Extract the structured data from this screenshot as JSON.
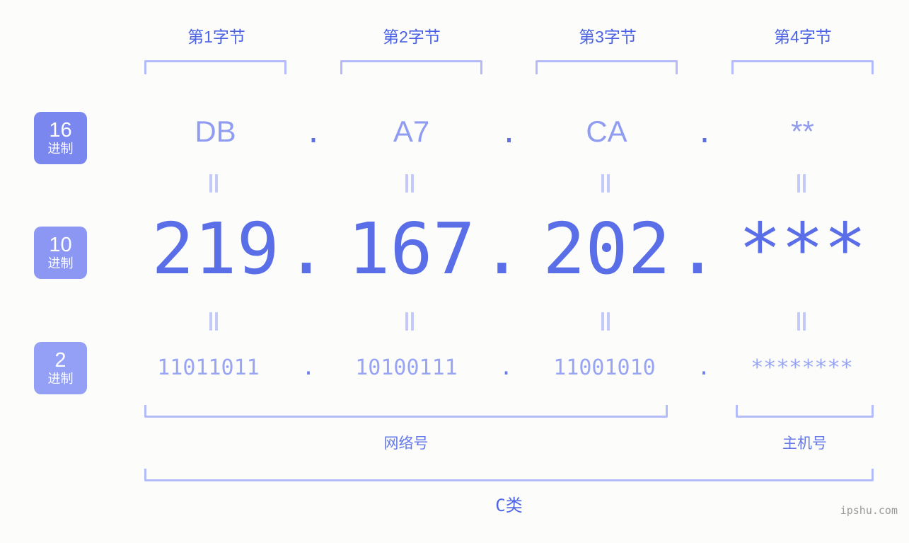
{
  "page": {
    "background": "#fcfdfa",
    "accent": "#5a6ee8",
    "accent_light": "#b3bcf9",
    "watermark": "ipshu.com"
  },
  "byte_headers": [
    {
      "label": "第1字节"
    },
    {
      "label": "第2字节"
    },
    {
      "label": "第3字节"
    },
    {
      "label": "第4字节"
    }
  ],
  "bases": [
    {
      "num": "16",
      "sub": "进制",
      "color": "#7a87ef"
    },
    {
      "num": "10",
      "sub": "进制",
      "color": "#8b97f2"
    },
    {
      "num": "2",
      "sub": "进制",
      "color": "#93a0f5"
    }
  ],
  "rows": {
    "hex": {
      "values": [
        "DB",
        "A7",
        "CA",
        "**"
      ],
      "separator": "."
    },
    "decimal": {
      "values": [
        "219",
        "167",
        "202",
        "***"
      ],
      "separator": "."
    },
    "binary": {
      "values": [
        "11011011",
        "10100111",
        "11001010",
        "********"
      ],
      "separator": "."
    }
  },
  "equality_mark": "=",
  "parts": {
    "network": "网络号",
    "host": "主机号"
  },
  "address_class": "C类"
}
